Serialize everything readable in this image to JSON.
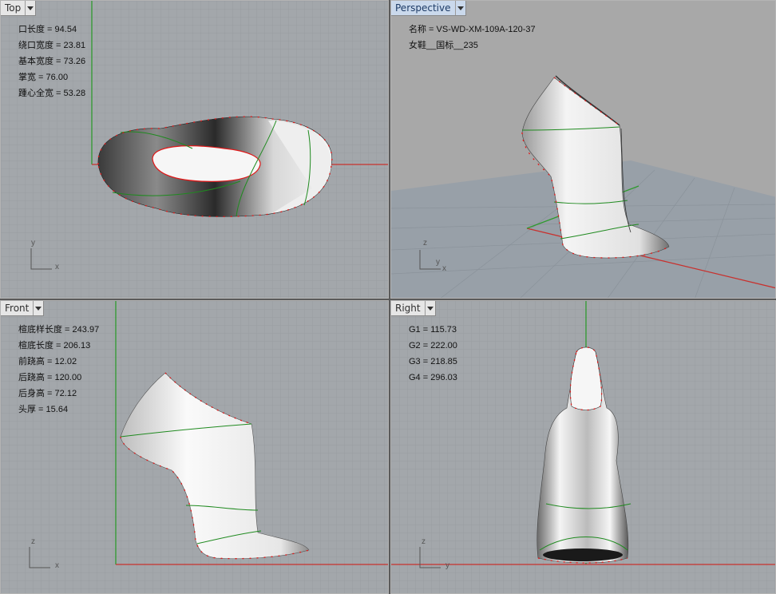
{
  "viewports": {
    "top": {
      "title": "Top",
      "measurements": [
        "口长度 = 94.54",
        "绕口宽度 = 23.81",
        "基本宽度 = 73.26",
        "掌宽 = 76.00",
        "踵心全宽 = 53.28"
      ],
      "axes": [
        "y",
        "x"
      ]
    },
    "perspective": {
      "title": "Perspective",
      "measurements": [
        "名称 = VS-WD-XM-109A-120-37",
        "女鞋__国标__235"
      ],
      "axes": [
        "z",
        "y",
        "x"
      ]
    },
    "front": {
      "title": "Front",
      "measurements": [
        "楦底样长度 = 243.97",
        "楦底长度 = 206.13",
        "前跷高 = 12.02",
        "后跷高 = 120.00",
        "后身高 = 72.12",
        "头厚 = 15.64"
      ],
      "axes": [
        "z",
        "x"
      ]
    },
    "right": {
      "title": "Right",
      "measurements": [
        "G1 = 115.73",
        "G2 = 222.00",
        "G3 = 218.85",
        "G4 = 296.03"
      ],
      "axes": [
        "z",
        "y"
      ]
    }
  },
  "colors": {
    "grid_background": "#a3a7ab",
    "grid_line": "#969a9e",
    "perspective_sky": "#a8a8a8",
    "perspective_floor": "#98a0a8",
    "axis_x": "#c8312e",
    "axis_y": "#2f9a2f",
    "curve": "#1f8a1f",
    "control_point": "#e01818",
    "active_tab": "#cad9ec"
  }
}
